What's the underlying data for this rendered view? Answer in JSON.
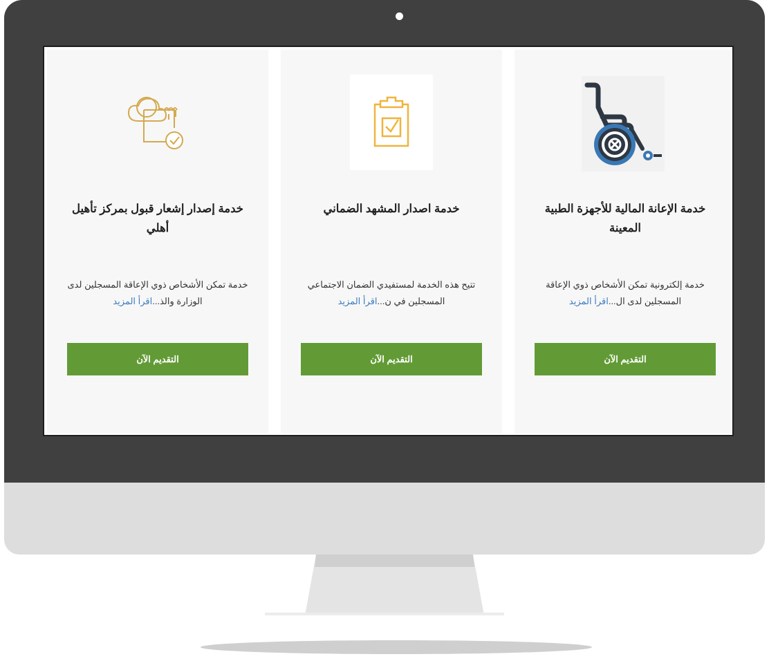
{
  "cards": [
    {
      "title": "خدمة الإعانة المالية للأجهزة الطبية المعينة",
      "description": "خدمة إلكترونية تمكن الأشخاص ذوي الإعاقة المسجلين لدى ال...",
      "read_more": "اقرأ المزيد",
      "button": "التقديم الآن",
      "icon": "wheelchair-icon"
    },
    {
      "title": "خدمة اصدار المشهد الضماني",
      "description": "تتيح هذه الخدمة لمستفيدي الضمان الاجتماعي المسجلين في ن...",
      "read_more": "اقرأ المزيد",
      "button": "التقديم الآن",
      "icon": "clipboard-check-icon"
    },
    {
      "title": "خدمة إصدار إشعار قبول بمركز تأهيل أهلي",
      "description": "خدمة تمكن الأشخاص ذوي الإعاقة المسجلين لدى الوزارة والذ...",
      "read_more": "اقرأ المزيد",
      "button": "التقديم الآن",
      "icon": "cloud-document-check-icon"
    }
  ],
  "colors": {
    "button": "#629b36",
    "link": "#3d7bbf",
    "icon_gold": "#d4a94f",
    "icon_orange": "#f0b43c",
    "wheelchair_dark": "#2e3844",
    "wheelchair_blue": "#3a78b5",
    "monitor_bezel": "#3f403f"
  }
}
